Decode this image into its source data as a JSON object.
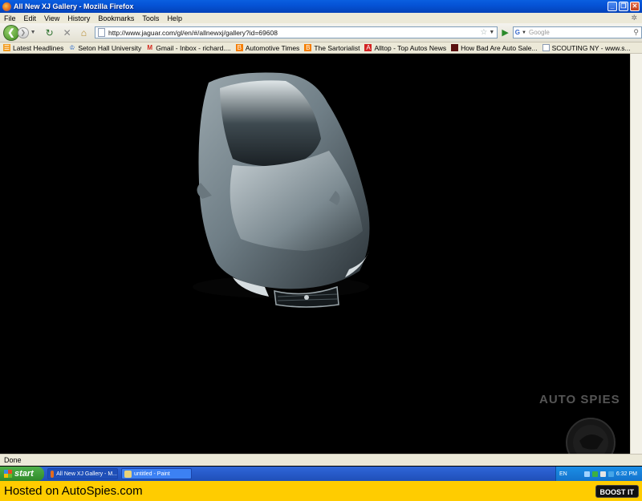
{
  "window": {
    "title": "All New XJ Gallery - Mozilla Firefox"
  },
  "menu": {
    "items": [
      "File",
      "Edit",
      "View",
      "History",
      "Bookmarks",
      "Tools",
      "Help"
    ]
  },
  "nav": {
    "url": "http://www.jaguar.com/gl/en/#/allnewxj/gallery?id=69608",
    "search_placeholder": "Google"
  },
  "bookmarks": {
    "items": [
      {
        "label": "Latest Headlines",
        "icon": "rss-icon"
      },
      {
        "label": "Seton Hall University",
        "icon": "crown-icon"
      },
      {
        "label": "Gmail - Inbox - richard....",
        "icon": "gmail-icon"
      },
      {
        "label": "Automotive Times",
        "icon": "blogger-icon"
      },
      {
        "label": "The Sartorialist",
        "icon": "blogger-icon"
      },
      {
        "label": "Alltop - Top Autos News",
        "icon": "alltop-icon"
      },
      {
        "label": "How Bad Are Auto Sale...",
        "icon": "dark-square-icon"
      },
      {
        "label": "SCOUTING NY - www.s...",
        "icon": "page-icon"
      }
    ]
  },
  "content": {
    "watermark": "AUTO SPIES"
  },
  "status": {
    "text": "Done"
  },
  "taskbar": {
    "start_label": "start",
    "tasks": [
      {
        "label": "All New XJ Gallery - M..."
      },
      {
        "label": "untitled - Paint"
      }
    ],
    "tray": {
      "lang": "EN",
      "time": "6:32 PM"
    }
  },
  "footer": {
    "hosted": "Hosted on AutoSpies.com",
    "boost": "BOOST IT"
  },
  "colors": {
    "titlebar": "#0553d6",
    "footer": "#ffcc00",
    "taskbar": "#2a5fcf"
  }
}
